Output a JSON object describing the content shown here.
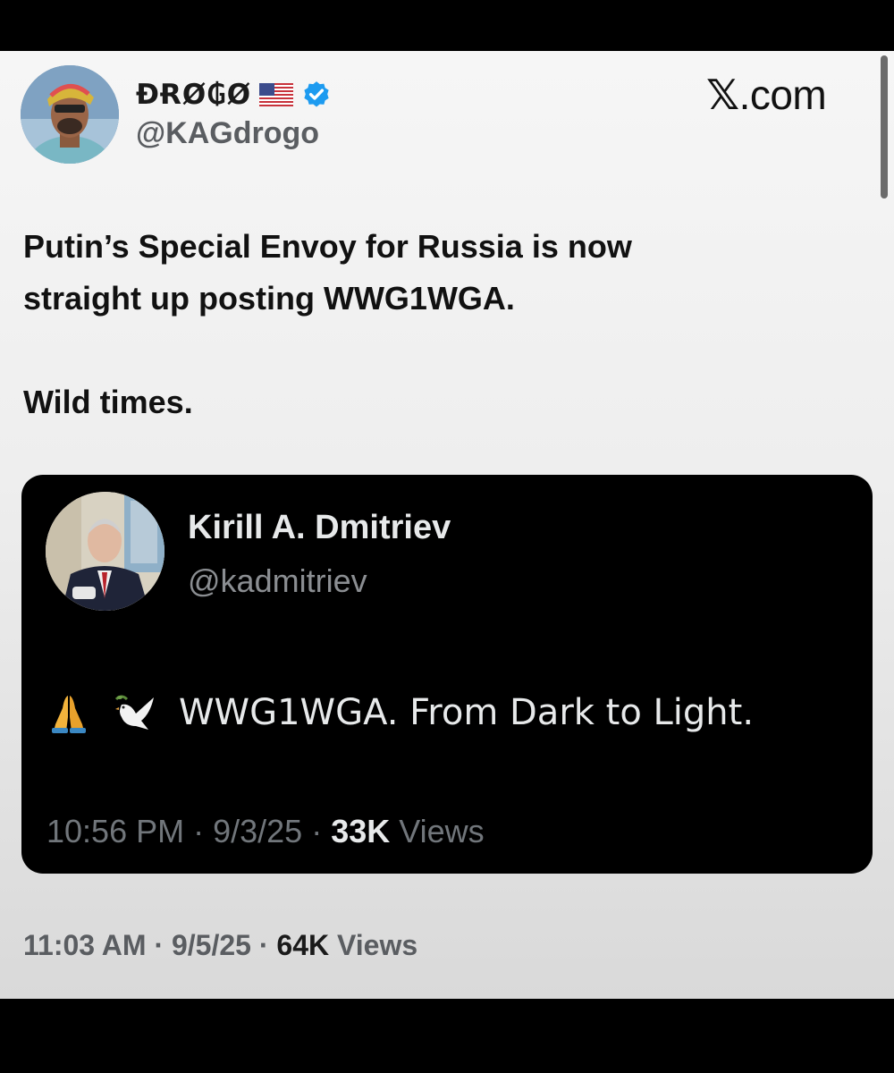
{
  "post": {
    "author": {
      "display_name": "ĐɌØ₲Ø",
      "handle": "@KAGdrogo",
      "verified": true,
      "flag_icon": "us-flag-icon",
      "avatar_icon": "avatar-icon"
    },
    "source_label_x": "𝕏",
    "source_label_rest": ".com",
    "text_lines": [
      "Putin’s Special Envoy for Russia is now",
      "straight up posting WWG1WGA."
    ],
    "text_line_2": "Wild times.",
    "quoted": {
      "display_name": "Kirill A. Dmitriev",
      "handle": "@kadmitriev",
      "emojis": [
        "folded-hands-icon",
        "dove-icon"
      ],
      "text": "WWG1WGA. From Dark to Light.",
      "time": "10:56 PM",
      "date": "9/3/25",
      "views_count": "33K",
      "views_label": "Views",
      "separator": " · "
    },
    "meta": {
      "time": "11:03 AM",
      "date": "9/5/25",
      "views_count": "64K",
      "views_label": "Views",
      "separator": " · "
    }
  },
  "colors": {
    "verified_blue": "#1d9bf0",
    "quote_bg": "#000000",
    "text_dark": "#111111",
    "text_gray": "#5a5d61"
  }
}
